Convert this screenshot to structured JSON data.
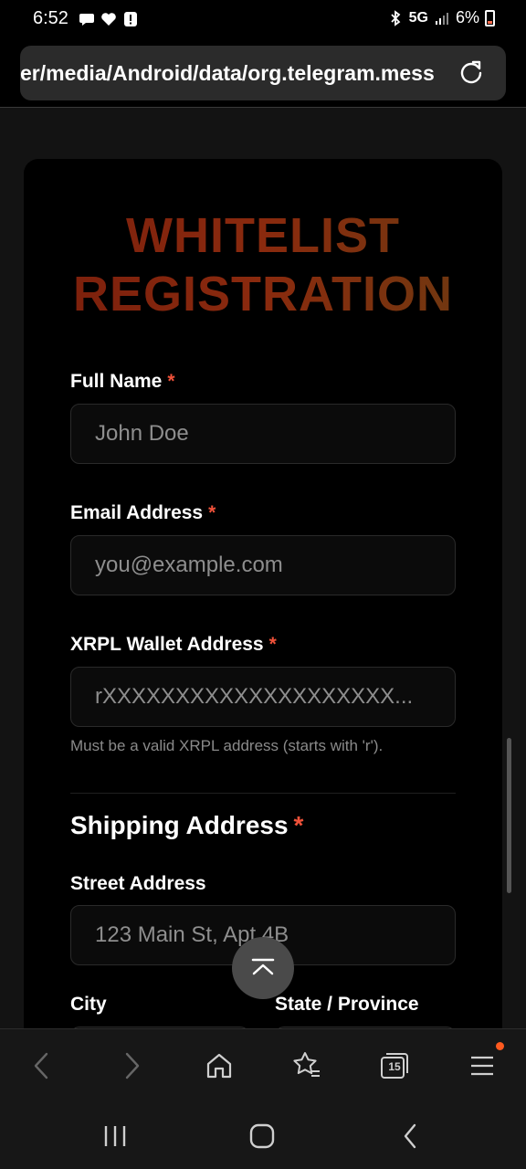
{
  "status_bar": {
    "time": "6:52",
    "network": "5G",
    "battery": "6%"
  },
  "browser": {
    "url": "er/media/Android/data/org.telegram.mess",
    "tab_count": "15"
  },
  "form": {
    "title_line1": "WHITELIST",
    "title_line2": "REGISTRATION",
    "required_mark": "*",
    "full_name": {
      "label": "Full Name",
      "placeholder": "John Doe"
    },
    "email": {
      "label": "Email Address",
      "placeholder": "you@example.com"
    },
    "wallet": {
      "label": "XRPL Wallet Address",
      "placeholder": "rXXXXXXXXXXXXXXXXXXXX...",
      "hint": "Must be a valid XRPL address (starts with 'r')."
    },
    "shipping": {
      "title": "Shipping Address",
      "street": {
        "label": "Street Address",
        "placeholder": "123 Main St, Apt 4B"
      },
      "city": {
        "label": "City"
      },
      "state": {
        "label": "State / Province"
      }
    }
  },
  "colors": {
    "required": "#f0523a",
    "title_gradient_start": "#7a1e0c",
    "title_gradient_end": "#6b3a10",
    "notification_dot": "#ff5a1f"
  }
}
